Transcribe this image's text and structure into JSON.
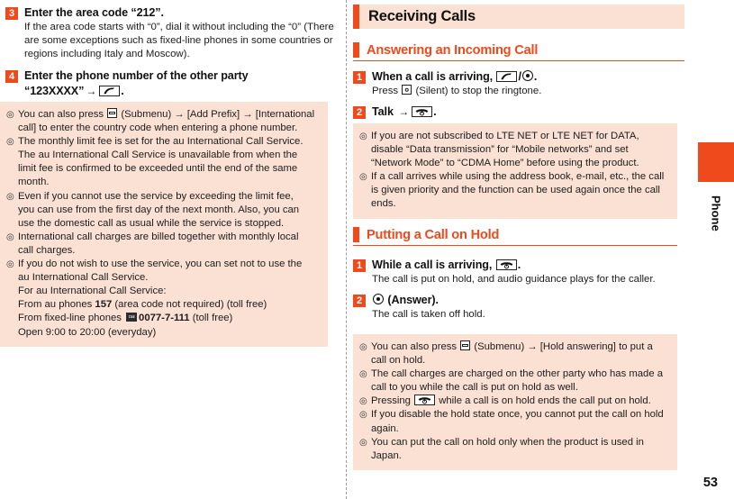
{
  "left": {
    "steps": [
      {
        "num": "3",
        "title": "Enter the area code “212”.",
        "lines": [
          "If the area code starts with “0”, dial it without including the “0”",
          "(There are some exceptions such as fixed-line phones in some",
          "countries or regions including Italy and Moscow)."
        ]
      },
      {
        "num": "4",
        "title_pre": "Enter the phone number of the other party",
        "title_post": "“123XXXX”",
        "title_end": "."
      }
    ],
    "note": {
      "items": [
        {
          "pre": "You can also press ",
          "mid": " (Submenu) ",
          "post": " [Add Prefix] ",
          "post2": " [International",
          "cont": [
            "call] to enter the country code when entering a phone number."
          ]
        },
        {
          "text": "The monthly limit fee is set for the au International Call Service.",
          "cont": [
            "The au International Call Service is unavailable from when the",
            "limit fee is confirmed to be exceeded until the end of the same",
            "month."
          ]
        },
        {
          "text": "Even if you cannot use the service by exceeding the limit fee,",
          "cont": [
            "you can use from the first day of the next month. Also, you can",
            "use the domestic call as usual while the service is stopped."
          ]
        },
        {
          "text": "International call charges are billed together with monthly local",
          "cont": [
            "call charges."
          ]
        },
        {
          "text": "If you do not wish to use the service, you can set not to use the",
          "cont": [
            "au International Call Service.",
            "For au International Call Service:"
          ],
          "au_line_pre": "From au phones ",
          "au_line_bold": "157",
          "au_line_post": " (area code not required) (toll free)",
          "fixed_pre": "From fixed-line phones ",
          "fixed_bold": "0077-7-111",
          "fixed_post": " (toll free)",
          "open_line": "Open 9:00 to 20:00 (everyday)"
        }
      ]
    }
  },
  "right": {
    "h1": "Receiving Calls",
    "section1": {
      "h2": "Answering an Incoming Call",
      "steps": [
        {
          "num": "1",
          "title_pre": "When a call is arriving, ",
          "title_mid": "/",
          "title_end": ".",
          "sub_pre": "Press ",
          "sub_post": " (Silent) to stop the ringtone."
        },
        {
          "num": "2",
          "title_pre": "Talk ",
          "title_end": "."
        }
      ],
      "note": {
        "items": [
          {
            "text": "If you are not subscribed to LTE NET or LTE NET for DATA,",
            "cont": [
              "disable “Data transmission” for “Mobile networks” and set",
              "“Network Mode” to “CDMA Home” before using the product."
            ]
          },
          {
            "text": "If a call arrives while using the address book, e-mail, etc., the call",
            "cont": [
              "is given priority and the function can be used again once the call",
              "ends."
            ]
          }
        ]
      }
    },
    "section2": {
      "h2": "Putting a Call on Hold",
      "steps": [
        {
          "num": "1",
          "title_pre": "While a call is arriving, ",
          "title_end": ".",
          "sub": "The call is put on hold, and audio guidance plays for the caller."
        },
        {
          "num": "2",
          "title_post": " (Answer).",
          "sub": "The call is taken off hold."
        }
      ],
      "note": {
        "items": [
          {
            "pre": "You can also press ",
            "mid": " (Submenu) ",
            "post": " [Hold answering] to put a",
            "cont": [
              "call on hold."
            ]
          },
          {
            "text": "The call charges are charged on the other party who has made a",
            "cont": [
              "call to you while the call is put on hold as well."
            ]
          },
          {
            "pre": "Pressing ",
            "post": " while a call is on hold ends the call put on hold.",
            "cont": []
          },
          {
            "text": "If you disable the hold state once, you cannot put the call on hold",
            "cont": [
              "again."
            ]
          },
          {
            "text": "You can put the call on hold only when the product is used in",
            "cont": [
              "Japan."
            ]
          }
        ]
      }
    }
  },
  "thumbtab": {
    "label": "Phone"
  },
  "page_number": "53",
  "colors": {
    "accent": "#ef4a1c",
    "note_bg": "#fae1d4",
    "text": "#1a1a1a"
  },
  "icons": {
    "call_key": "call-key-icon",
    "end_key": "end-call-key-icon",
    "center_key": "center-select-key-icon",
    "submenu": "submenu-key-icon",
    "camera": "camera-key-icon",
    "free_dial": "free-dial-mark-icon",
    "arrow": "→",
    "bullet": "◎",
    "free_dial_text": "Free Dial"
  }
}
